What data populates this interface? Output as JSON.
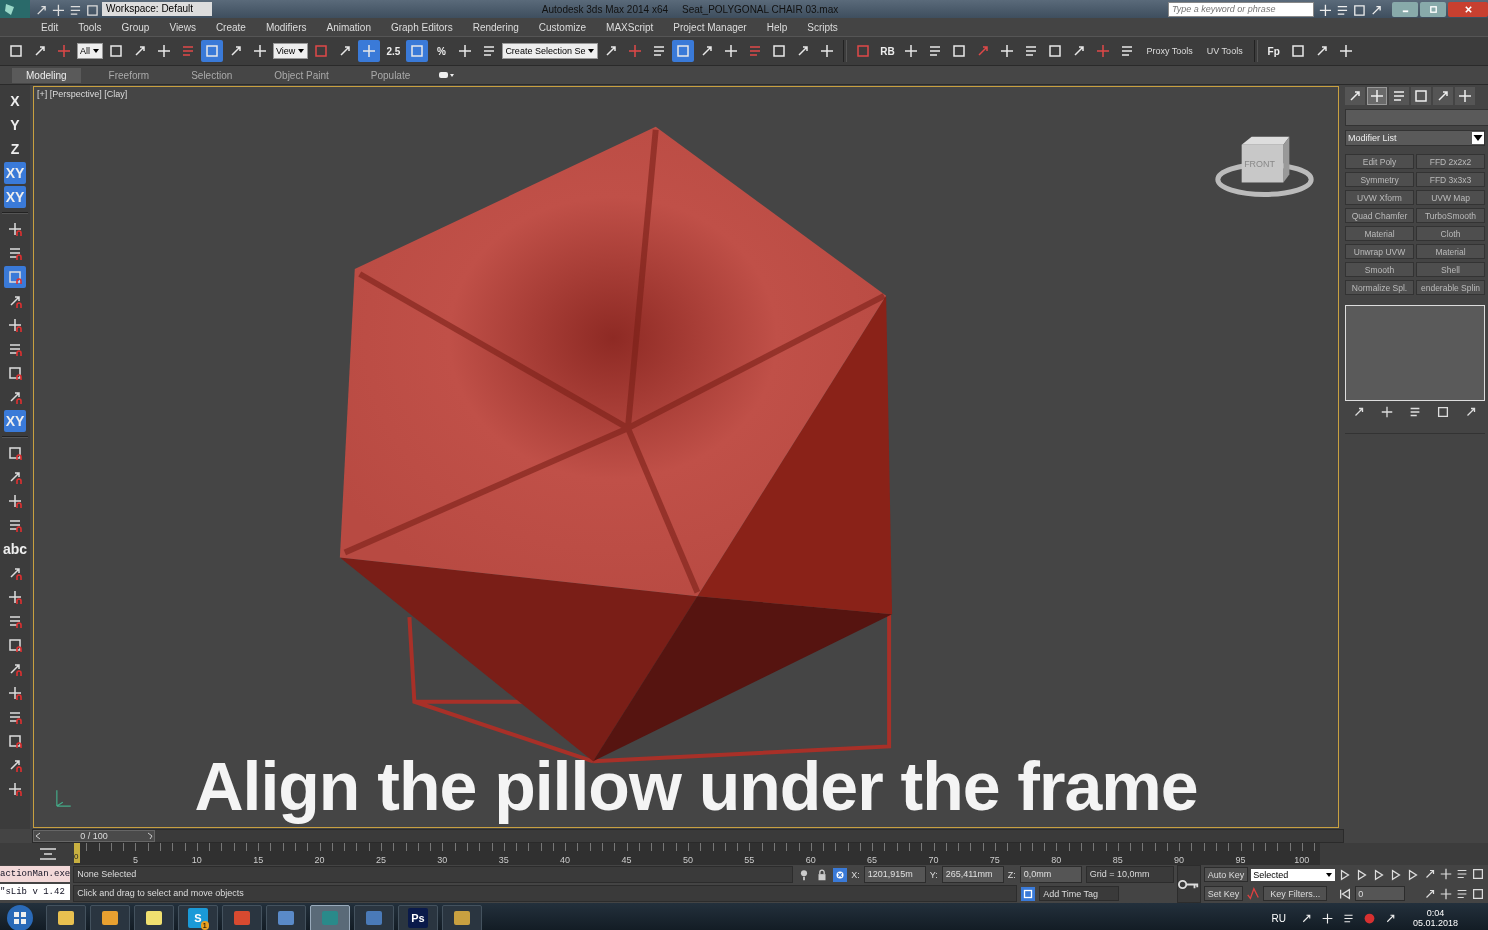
{
  "title_bar": {
    "workspace": "Workspace: Default",
    "app_title": "Autodesk 3ds Max  2014 x64",
    "file_name": "Seat_POLYGONAL CHAIR 03.max",
    "search": {
      "placeholder": "Type a keyword or phrase"
    }
  },
  "menu": [
    "Edit",
    "Tools",
    "Group",
    "Views",
    "Create",
    "Modifiers",
    "Animation",
    "Graph Editors",
    "Rendering",
    "Customize",
    "MAXScript",
    "Project Manager",
    "Help",
    "Scripts"
  ],
  "main_toolbar": [
    {
      "kind": "icon",
      "selected": false
    },
    {
      "kind": "icon",
      "selected": false
    },
    {
      "kind": "icon",
      "selected": false
    },
    {
      "kind": "dropdown",
      "value": "All"
    },
    {
      "kind": "icon",
      "selected": false
    },
    {
      "kind": "icon",
      "selected": false
    },
    {
      "kind": "icon",
      "selected": false
    },
    {
      "kind": "icon",
      "selected": false
    },
    {
      "kind": "icon",
      "selected": true
    },
    {
      "kind": "icon",
      "selected": false
    },
    {
      "kind": "icon",
      "selected": false
    },
    {
      "kind": "dropdown",
      "value": "View"
    },
    {
      "kind": "icon",
      "selected": false
    },
    {
      "kind": "icon",
      "selected": false
    },
    {
      "kind": "icon",
      "selected": true
    },
    {
      "kind": "text_icon",
      "label": "2.5",
      "selected": false
    },
    {
      "kind": "icon",
      "selected": true
    },
    {
      "kind": "text_icon",
      "label": "%",
      "selected": false
    },
    {
      "kind": "icon",
      "selected": false
    },
    {
      "kind": "icon",
      "selected": false
    },
    {
      "kind": "dropdown",
      "value": "Create Selection Se"
    },
    {
      "kind": "icon",
      "selected": false
    },
    {
      "kind": "icon",
      "selected": false
    },
    {
      "kind": "icon",
      "selected": false
    },
    {
      "kind": "icon",
      "selected": true
    },
    {
      "kind": "icon",
      "selected": false
    },
    {
      "kind": "icon",
      "selected": false
    },
    {
      "kind": "icon",
      "selected": false
    },
    {
      "kind": "icon",
      "selected": false
    },
    {
      "kind": "icon",
      "selected": false
    },
    {
      "kind": "icon",
      "selected": false
    },
    {
      "kind": "separator"
    },
    {
      "kind": "icon",
      "selected": false
    },
    {
      "kind": "text_icon",
      "label": "RB",
      "selected": false
    },
    {
      "kind": "icon",
      "selected": false
    },
    {
      "kind": "icon",
      "selected": false
    },
    {
      "kind": "icon",
      "selected": false
    },
    {
      "kind": "icon",
      "selected": false
    },
    {
      "kind": "icon",
      "selected": false
    },
    {
      "kind": "icon",
      "selected": false
    },
    {
      "kind": "icon",
      "selected": false
    },
    {
      "kind": "icon",
      "selected": false
    },
    {
      "kind": "icon",
      "selected": false
    },
    {
      "kind": "icon",
      "selected": false
    },
    {
      "kind": "label",
      "label": "Proxy Tools"
    },
    {
      "kind": "label",
      "label": "UV Tools"
    },
    {
      "kind": "separator"
    },
    {
      "kind": "text_icon",
      "label": "Fp",
      "selected": false
    },
    {
      "kind": "icon",
      "selected": false
    },
    {
      "kind": "icon",
      "selected": false
    },
    {
      "kind": "icon",
      "selected": false
    }
  ],
  "ribbon_tabs": [
    {
      "label": "Modeling",
      "selected": true
    },
    {
      "label": "Freeform",
      "selected": false
    },
    {
      "label": "Selection",
      "selected": false
    },
    {
      "label": "Object Paint",
      "selected": false
    },
    {
      "label": "Populate",
      "selected": false
    }
  ],
  "left_toolbar": [
    {
      "kind": "text",
      "label": "X",
      "selected": false
    },
    {
      "kind": "text",
      "label": "Y",
      "selected": false
    },
    {
      "kind": "text",
      "label": "Z",
      "selected": false
    },
    {
      "kind": "text",
      "label": "XY",
      "selected": true
    },
    {
      "kind": "text",
      "label": "XY",
      "selected": true
    },
    {
      "kind": "separator"
    },
    {
      "kind": "icon",
      "selected": false
    },
    {
      "kind": "icon",
      "selected": false
    },
    {
      "kind": "icon",
      "selected": true
    },
    {
      "kind": "icon",
      "selected": false
    },
    {
      "kind": "icon",
      "selected": false
    },
    {
      "kind": "icon",
      "selected": false
    },
    {
      "kind": "icon",
      "selected": false
    },
    {
      "kind": "icon",
      "selected": false
    },
    {
      "kind": "text",
      "label": "XY",
      "selected": true
    },
    {
      "kind": "separator"
    },
    {
      "kind": "icon",
      "selected": false
    },
    {
      "kind": "icon",
      "selected": false
    },
    {
      "kind": "icon",
      "selected": false
    },
    {
      "kind": "icon",
      "selected": false
    },
    {
      "kind": "text",
      "label": "abc",
      "selected": false
    },
    {
      "kind": "icon",
      "selected": false
    },
    {
      "kind": "icon",
      "selected": false
    },
    {
      "kind": "icon",
      "selected": false
    },
    {
      "kind": "icon",
      "selected": false
    },
    {
      "kind": "icon",
      "selected": false
    },
    {
      "kind": "icon",
      "selected": false
    },
    {
      "kind": "icon",
      "selected": false
    },
    {
      "kind": "icon",
      "selected": false
    },
    {
      "kind": "icon",
      "selected": false
    },
    {
      "kind": "icon",
      "selected": false
    }
  ],
  "viewport": {
    "label": "[+] [Perspective] [Clay]",
    "view_cube": "FRONT",
    "caption": "Align the pillow under the frame"
  },
  "command_panel": {
    "tabs": [
      {
        "selected": false
      },
      {
        "selected": true
      },
      {
        "selected": false
      },
      {
        "selected": false
      },
      {
        "selected": false
      },
      {
        "selected": false
      }
    ],
    "modifier_list": "Modifier List",
    "modifier_buttons": [
      "Edit Poly",
      "FFD 2x2x2",
      "Symmetry",
      "FFD 3x3x3",
      "UVW Xform",
      "UVW Map",
      "Quad Chamfer",
      "TurboSmooth",
      "Material",
      "Cloth",
      "Unwrap UVW",
      "Material",
      "Smooth",
      "Shell",
      "Normalize Spl.",
      "enderable Splin"
    ]
  },
  "time_slider": {
    "label": "0 / 100"
  },
  "track_bar": {
    "current": "0",
    "ticks": [
      "5",
      "10",
      "15",
      "20",
      "25",
      "30",
      "35",
      "40",
      "45",
      "50",
      "55",
      "60",
      "65",
      "70",
      "75",
      "80",
      "85",
      "90",
      "95",
      "100"
    ]
  },
  "status": {
    "listener": [
      "actionMan.exe",
      "\"sLib v 1.42"
    ],
    "selection": "None Selected",
    "prompt": "Click and drag to select and move objects",
    "coords": [
      {
        "axis": "X:",
        "value": "1201,915m"
      },
      {
        "axis": "Y:",
        "value": "265,411mm"
      },
      {
        "axis": "Z:",
        "value": "0,0mm"
      }
    ],
    "grid": "Grid = 10,0mm",
    "add_time_tag": "Add Time Tag",
    "auto_key": "Auto Key",
    "set_key": "Set Key",
    "key_mode": "Selected",
    "key_filters": "Key Filters...",
    "frame": "0"
  },
  "taskbar": {
    "apps": [
      {
        "selected": false
      },
      {
        "selected": false
      },
      {
        "selected": false
      },
      {
        "selected": false,
        "label": "S",
        "badge": "1"
      },
      {
        "selected": false
      },
      {
        "selected": false
      },
      {
        "selected": true
      },
      {
        "selected": false
      },
      {
        "selected": false,
        "label": "Ps"
      },
      {
        "selected": false
      }
    ],
    "language": "RU",
    "time": "0:04",
    "date": "05.01.2018"
  }
}
